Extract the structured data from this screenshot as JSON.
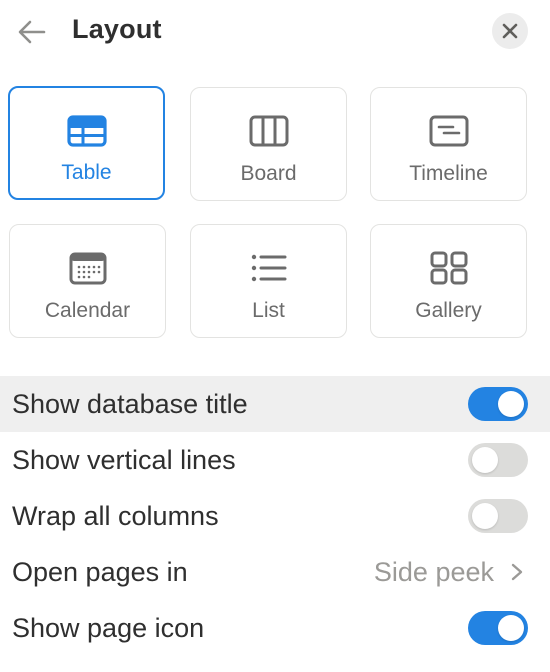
{
  "header": {
    "title": "Layout",
    "back_icon": "arrow-left-icon",
    "close_icon": "close-icon"
  },
  "layouts": [
    {
      "label": "Table",
      "icon": "table-icon",
      "selected": true
    },
    {
      "label": "Board",
      "icon": "board-icon",
      "selected": false
    },
    {
      "label": "Timeline",
      "icon": "timeline-icon",
      "selected": false
    },
    {
      "label": "Calendar",
      "icon": "calendar-icon",
      "selected": false
    },
    {
      "label": "List",
      "icon": "list-icon",
      "selected": false
    },
    {
      "label": "Gallery",
      "icon": "gallery-icon",
      "selected": false
    }
  ],
  "settings": {
    "show_database_title": {
      "label": "Show database title",
      "on": true
    },
    "show_vertical_lines": {
      "label": "Show vertical lines",
      "on": false
    },
    "wrap_all_columns": {
      "label": "Wrap all columns",
      "on": false
    },
    "open_pages_in": {
      "label": "Open pages in",
      "value": "Side peek"
    },
    "show_page_icon": {
      "label": "Show page icon",
      "on": true
    }
  },
  "colors": {
    "accent": "#2383e2",
    "toggle_off": "#dcdcda",
    "highlight_row": "#efefef",
    "muted_text": "#9b9a97"
  }
}
